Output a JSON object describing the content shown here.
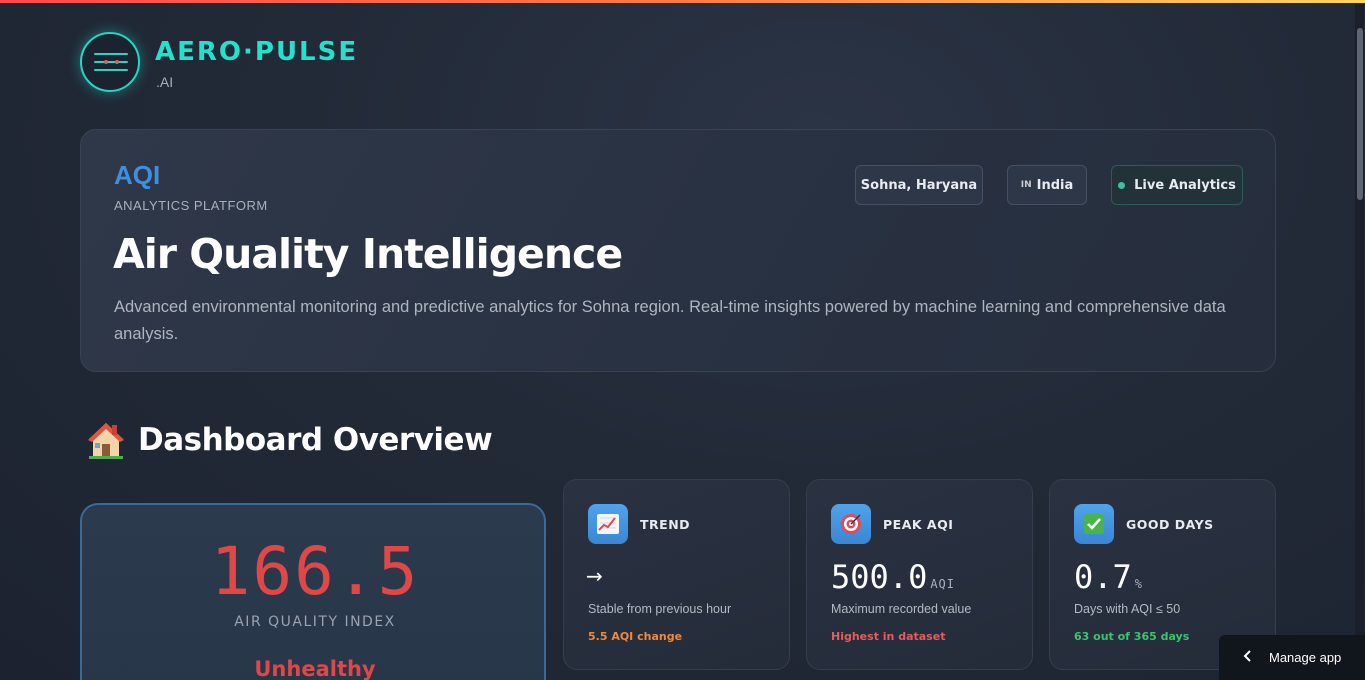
{
  "brand": {
    "name": "AERO·PULSE",
    "suffix": ".AI"
  },
  "hero": {
    "badge": "AQI",
    "badge_sub": "ANALYTICS PLATFORM",
    "title": "Air Quality Intelligence",
    "description": "Advanced environmental monitoring and predictive analytics for Sohna region. Real-time insights powered by machine learning and comprehensive data analysis.",
    "pills": {
      "location": "Sohna, Haryana",
      "country_code": "IN",
      "country": "India",
      "live": "Live Analytics"
    }
  },
  "section": {
    "title": "Dashboard Overview",
    "icon": "house-icon"
  },
  "aqi": {
    "value": "166.5",
    "label": "AIR QUALITY INDEX",
    "status": "Unhealthy",
    "status_color": "#e04848"
  },
  "cards": {
    "trend": {
      "title": "TREND",
      "icon": "chart-increasing-icon",
      "symbol": "→",
      "desc": "Stable from previous hour",
      "note": "5.5 AQI change",
      "note_color": "#f0883e"
    },
    "peak": {
      "title": "PEAK AQI",
      "icon": "target-icon",
      "value": "500.0",
      "unit": "AQI",
      "desc": "Maximum recorded value",
      "note": "Highest in dataset",
      "note_color": "#e65c5c"
    },
    "good": {
      "title": "GOOD DAYS",
      "icon": "check-mark-icon",
      "value": "0.7",
      "unit": "%",
      "desc": "Days with AQI ≤ 50",
      "note": "63 out of 365 days",
      "note_color": "#3cc46b"
    }
  },
  "manage_app": {
    "label": "Manage app"
  },
  "colors": {
    "accent": "#24e0cc",
    "blue": "#3f8fe0",
    "danger": "#e04848"
  }
}
